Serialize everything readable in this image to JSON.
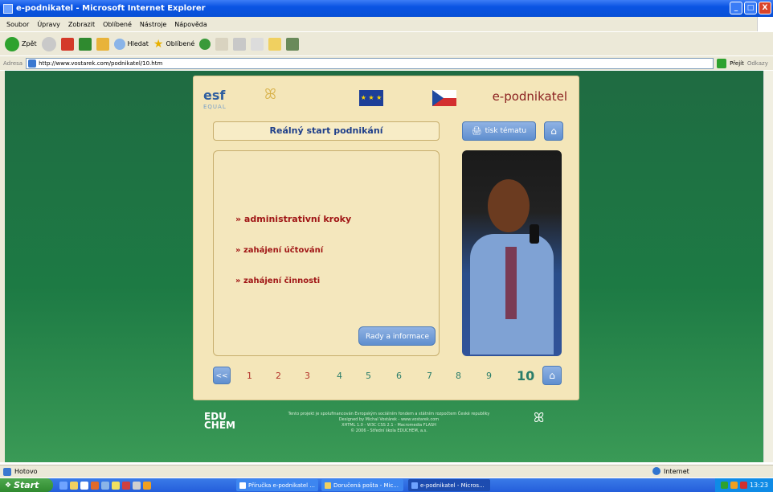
{
  "window": {
    "title": "e-podnikatel - Microsoft Internet Explorer",
    "minimize": "_",
    "maximize": "□",
    "close": "X"
  },
  "menu": [
    "Soubor",
    "Úpravy",
    "Zobrazit",
    "Oblíbené",
    "Nástroje",
    "Nápověda"
  ],
  "toolbar": {
    "back": "Zpět",
    "search": "Hledat",
    "favorites": "Oblíbené"
  },
  "address": {
    "label": "Adresa",
    "url": "http://www.vostarek.com/podnikatel/10.htm",
    "go": "Přejít",
    "links": "Odkazy"
  },
  "page": {
    "brand": "e-podnikatel",
    "esf": "esf",
    "equal": "EQUAL",
    "eu_stars": "★ ★ ★",
    "title": "Reálný start podnikání",
    "print": "tisk tématu",
    "home_glyph": "⌂",
    "prev": "<<",
    "links": [
      "» administrativní kroky",
      "» zahájení účtování",
      "» zahájení činnosti"
    ],
    "advice": "Rady a informace",
    "pages": [
      "1",
      "2",
      "3",
      "4",
      "5",
      "6",
      "7",
      "8",
      "9"
    ],
    "current_page": "10",
    "footer_logo_top": "EDU",
    "footer_logo_bottom": "CHEM",
    "credits": [
      "Tento projekt je spolufinancován Evropským sociálním fondem a státním rozpočtem České republiky",
      "Designed by Michal Vostárek - www.vostarek.com",
      "XHTML 1.0 - W3C CSS 2.1 - Macromedia FLASH",
      "© 2006 - Střední škola EDUCHEM, a.s."
    ]
  },
  "status": {
    "text": "Hotovo",
    "zone": "Internet"
  },
  "taskbar": {
    "start": "Start",
    "tasks": [
      "Příručka e-podnikatel ...",
      "Doručená pošta - Mic...",
      "e-podnikatel - Micros..."
    ],
    "clock": "13:23"
  },
  "colors": {
    "titlebar": "#0a54e3",
    "page_bg": "#1d7a44",
    "panel": "#f4e6b9",
    "link": "#a01616",
    "accent_blue": "#5f8fcf"
  }
}
